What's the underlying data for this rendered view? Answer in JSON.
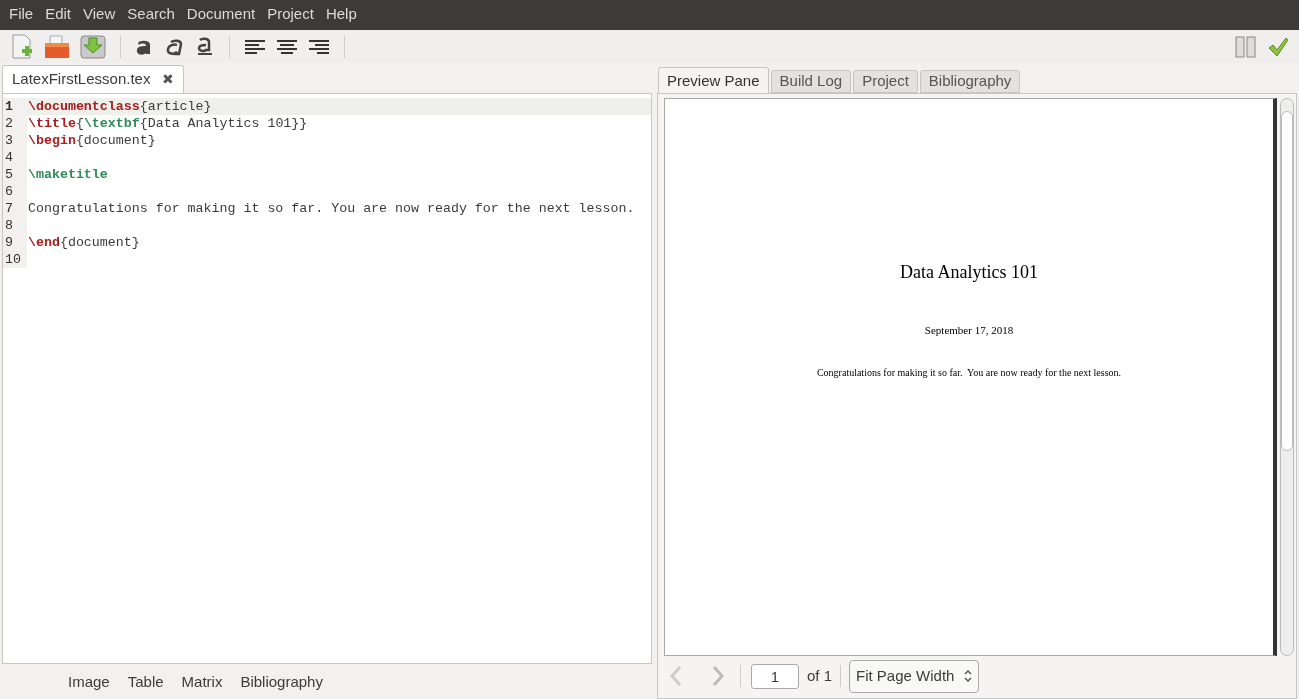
{
  "menu": [
    "File",
    "Edit",
    "View",
    "Search",
    "Document",
    "Project",
    "Help"
  ],
  "editor_tab": {
    "label": "LatexFirstLesson.tex",
    "close": "✖"
  },
  "code_lines": [
    {
      "number": "1",
      "current": true,
      "segments": [
        {
          "kind": "command",
          "text": "\\documentclass"
        },
        {
          "kind": "text",
          "text": "{article}"
        }
      ]
    },
    {
      "number": "2",
      "current": false,
      "segments": [
        {
          "kind": "command",
          "text": "\\title"
        },
        {
          "kind": "text",
          "text": "{"
        },
        {
          "kind": "format",
          "text": "\\textbf"
        },
        {
          "kind": "text",
          "text": "{Data Analytics 101}}"
        }
      ]
    },
    {
      "number": "3",
      "current": false,
      "segments": [
        {
          "kind": "command",
          "text": "\\begin"
        },
        {
          "kind": "text",
          "text": "{document}"
        }
      ]
    },
    {
      "number": "4",
      "current": false
    },
    {
      "number": "5",
      "current": false,
      "segments": [
        {
          "kind": "format",
          "text": "\\maketitle"
        }
      ]
    },
    {
      "number": "6",
      "current": false
    },
    {
      "number": "7",
      "current": false,
      "segments": [
        {
          "kind": "text",
          "text": "Congratulations for making it so far. You are now ready for the next lesson."
        }
      ]
    },
    {
      "number": "8",
      "current": false
    },
    {
      "number": "9",
      "current": false,
      "segments": [
        {
          "kind": "command",
          "text": "\\end"
        },
        {
          "kind": "text",
          "text": "{document}"
        }
      ]
    },
    {
      "number": "10",
      "current": false
    }
  ],
  "bottom_tabs": [
    "Image",
    "Table",
    "Matrix",
    "Bibliography"
  ],
  "preview_tabs": [
    {
      "label": "Preview Pane",
      "selected": true
    },
    {
      "label": "Build Log",
      "selected": false
    },
    {
      "label": "Project",
      "selected": false
    },
    {
      "label": "Bibliography",
      "selected": false
    }
  ],
  "document": {
    "title": "Data Analytics 101",
    "date": "September 17, 2018",
    "body": "Congratulations for making it so far.  You are now ready for the next lesson."
  },
  "pager": {
    "page": "1",
    "of": "of 1",
    "zoom": "Fit Page Width"
  }
}
